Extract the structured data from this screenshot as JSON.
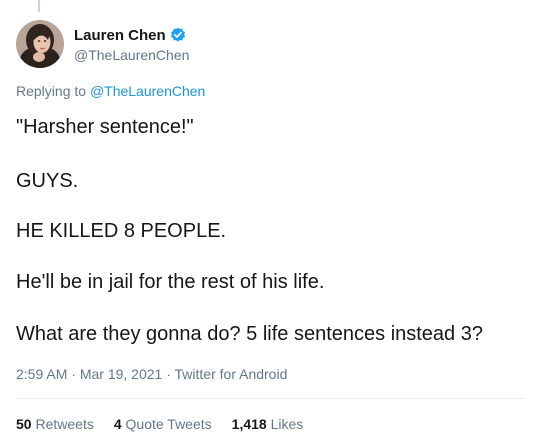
{
  "author": {
    "display_name": "Lauren Chen",
    "handle": "@TheLaurenChen",
    "verified": true
  },
  "reply": {
    "prefix": "Replying to",
    "mention": "@TheLaurenChen"
  },
  "body": {
    "lines": [
      "\"Harsher sentence!\"",
      "GUYS.",
      "HE KILLED 8 PEOPLE.",
      "He'll be in jail for the rest of his life.",
      "What are they gonna do? 5 life sentences instead 3?"
    ]
  },
  "meta": {
    "time": "2:59 AM",
    "separator": "·",
    "date": "Mar 19, 2021",
    "source": "Twitter for Android"
  },
  "stats": {
    "retweets_count": "50",
    "retweets_label": "Retweets",
    "quote_count": "4",
    "quote_label": "Quote Tweets",
    "likes_count": "1,418",
    "likes_label": "Likes"
  },
  "colors": {
    "accent": "#1b95e0",
    "verified": "#1da1f2",
    "secondary_text": "#657786",
    "primary_text": "#14171a"
  }
}
